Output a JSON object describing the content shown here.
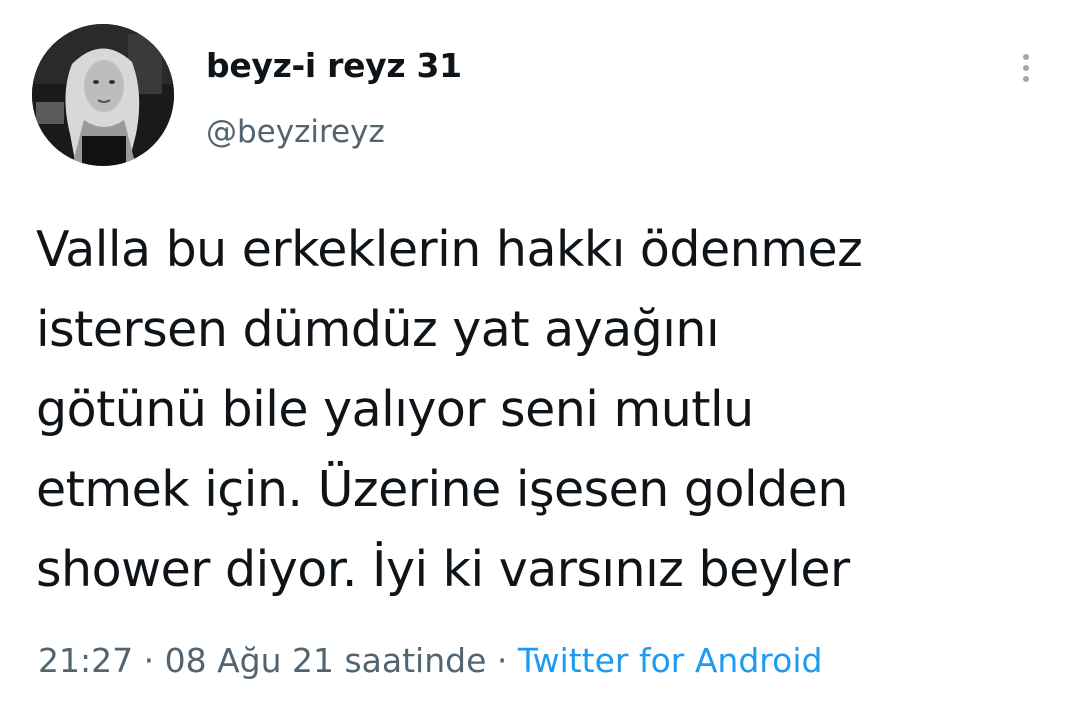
{
  "author": {
    "display_name": "beyz-i reyz 31",
    "handle": "@beyzireyz",
    "avatar_icon": "profile-photo"
  },
  "more_icon": "more-vertical-icon",
  "tweet": {
    "text": "Valla bu erkeklerin hakkı ödenmez\nistersen dümdüz yat ayağını\ngötünü bile yalıyor seni mutlu\netmek için. Üzerine işesen golden\nshower diyor. İyi ki varsınız beyler"
  },
  "meta": {
    "time": "21:27",
    "separator1": " · ",
    "date": "08 Ağu 21 saatinde",
    "separator2": " · ",
    "source": "Twitter for Android"
  },
  "colors": {
    "text": "#0f1419",
    "secondary": "#536471",
    "link": "#1d9bf0"
  }
}
